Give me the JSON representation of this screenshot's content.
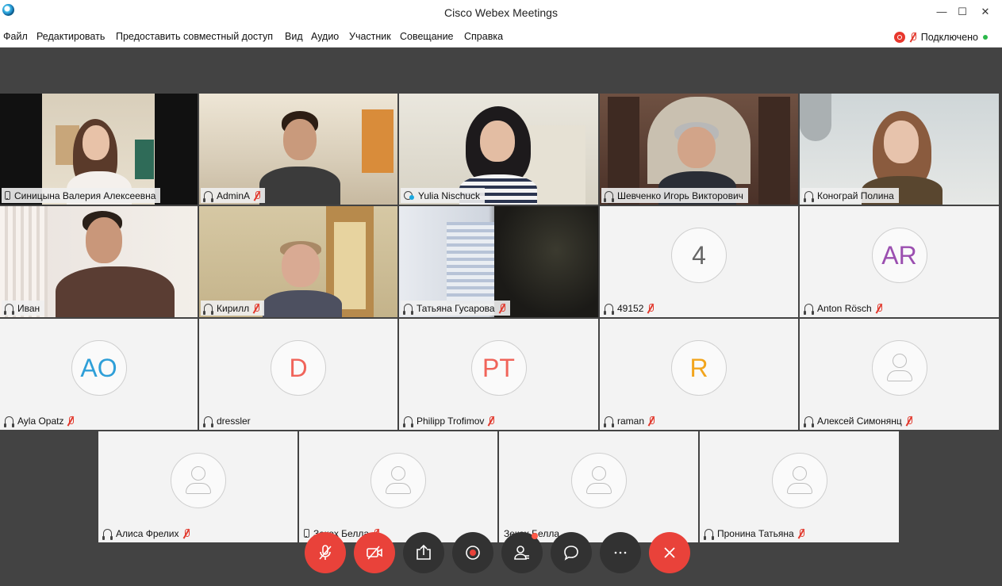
{
  "window": {
    "title": "Cisco Webex Meetings",
    "minimize": "—",
    "maximize": "☐",
    "close": "✕"
  },
  "menu": [
    "Файл",
    "Редактировать",
    "Предоставить совместный доступ",
    "Вид",
    "Аудио",
    "Участник",
    "Совещание",
    "Справка"
  ],
  "status": {
    "connection": "Подключено"
  },
  "participants": [
    {
      "name": "Синицына Валерия Алексеевна",
      "device": "phone-icon",
      "muted": false
    },
    {
      "name": "AdminA",
      "device": "audio-icon",
      "muted": true
    },
    {
      "name": "Yulia Nischuck",
      "device": "share-icon",
      "muted": false
    },
    {
      "name": "Шевченко Игорь Викторович",
      "device": "audio-icon",
      "muted": false,
      "active": true
    },
    {
      "name": "Конограй Полина",
      "device": "audio-icon",
      "muted": false
    },
    {
      "name": "Иван",
      "device": "audio-icon",
      "muted": false,
      "active": true
    },
    {
      "name": "Кирилл",
      "device": "audio-icon",
      "muted": true
    },
    {
      "name": "Татьяна Гусарова",
      "device": "audio-icon",
      "muted": true
    },
    {
      "name": "49152",
      "device": "audio-icon",
      "muted": true,
      "avatar": "4",
      "avatar_color": "#666666"
    },
    {
      "name": "Anton Rösch",
      "device": "audio-icon",
      "muted": true,
      "avatar": "AR",
      "avatar_color": "#9b4fb0"
    },
    {
      "name": "Ayla Opatz",
      "device": "audio-icon",
      "muted": true,
      "avatar": "AO",
      "avatar_color": "#2e9fd8"
    },
    {
      "name": "dressler",
      "device": "audio-icon",
      "muted": false,
      "avatar": "D",
      "avatar_color": "#f0645a"
    },
    {
      "name": "Philipp Trofimov",
      "device": "audio-icon",
      "muted": true,
      "avatar": "PT",
      "avatar_color": "#f0645a"
    },
    {
      "name": "raman",
      "device": "audio-icon",
      "muted": true,
      "avatar": "R",
      "avatar_color": "#f2a51d"
    },
    {
      "name": "Алексей Симонянц",
      "device": "audio-icon",
      "muted": true
    },
    {
      "name": "Алиса Фрелих",
      "device": "audio-icon",
      "muted": true
    },
    {
      "name": "Зекох Белла",
      "device": "phone-icon",
      "muted": true
    },
    {
      "name": "Зекох Белла",
      "device": "none",
      "muted": false
    },
    {
      "name": "Пронина Татьяна",
      "device": "audio-icon",
      "muted": true
    }
  ],
  "controls": [
    {
      "id": "mute",
      "icon": "mic-off-icon",
      "color": "#e9423a"
    },
    {
      "id": "video",
      "icon": "video-off-icon",
      "color": "#e9423a"
    },
    {
      "id": "share",
      "icon": "share-screen-icon",
      "color": "#323232"
    },
    {
      "id": "record",
      "icon": "record-icon",
      "color": "#323232"
    },
    {
      "id": "participants",
      "icon": "participants-icon",
      "color": "#323232"
    },
    {
      "id": "chat",
      "icon": "chat-icon",
      "color": "#323232"
    },
    {
      "id": "more",
      "icon": "more-icon",
      "color": "#323232"
    },
    {
      "id": "leave",
      "icon": "close-icon",
      "color": "#e9423a"
    }
  ]
}
